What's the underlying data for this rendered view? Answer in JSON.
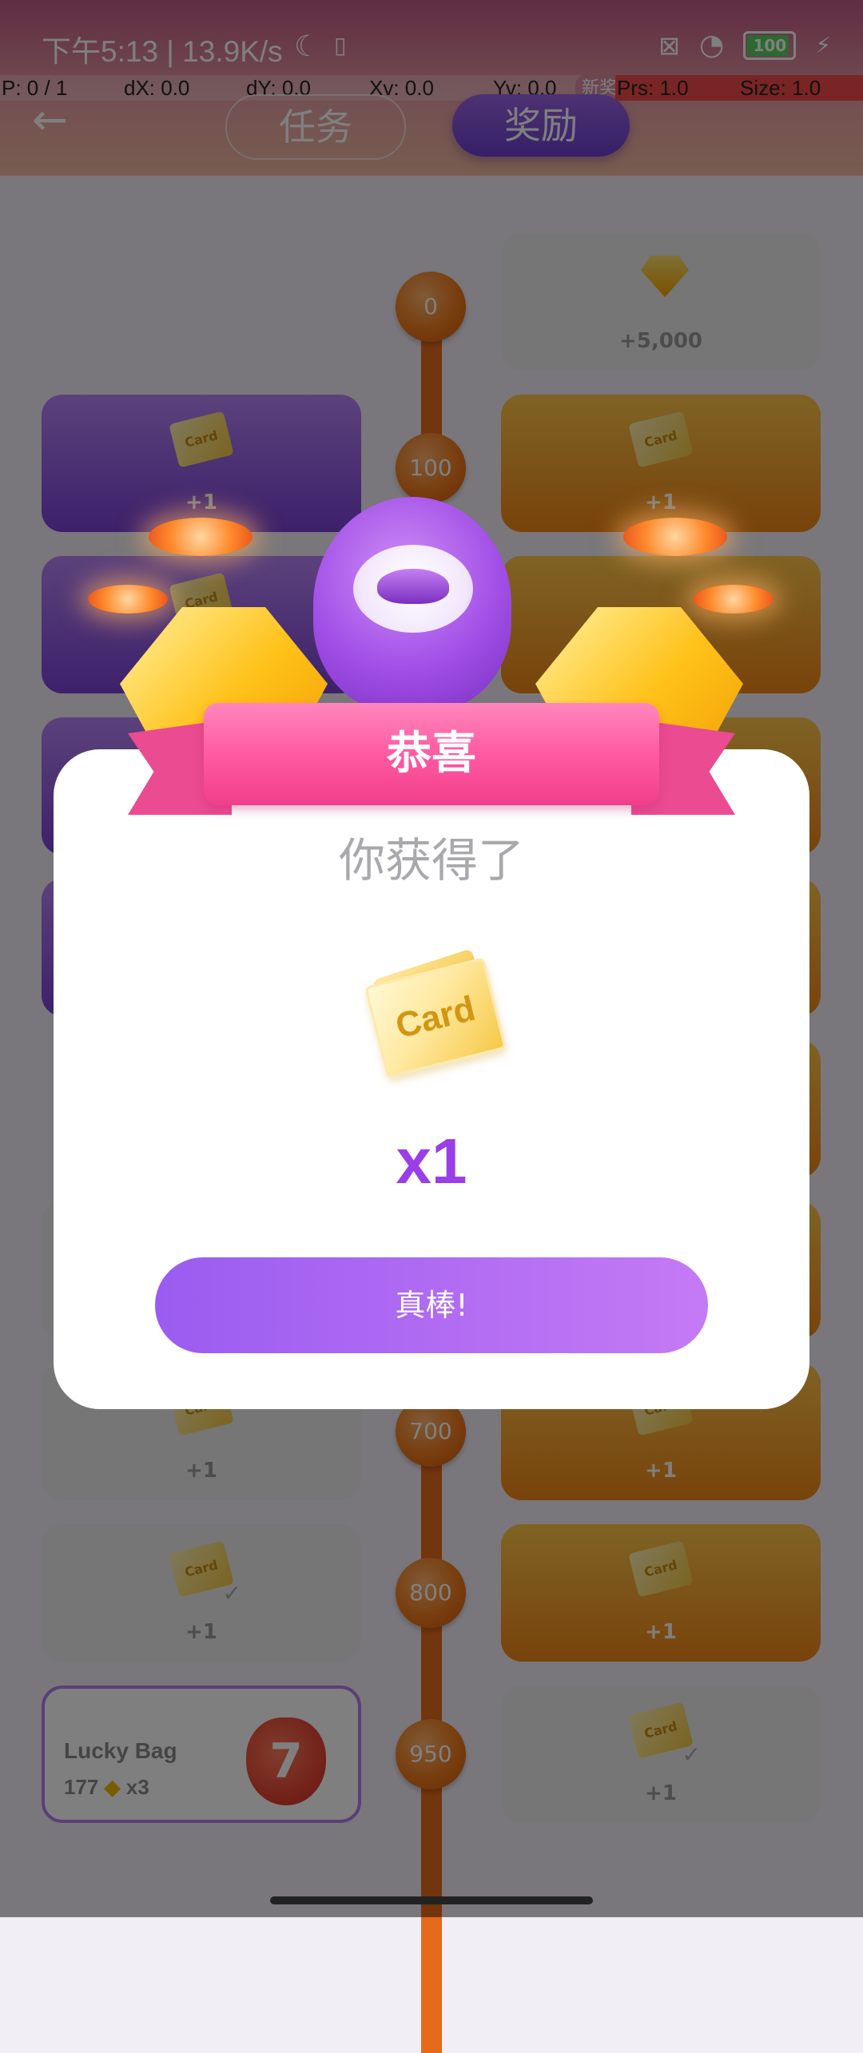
{
  "status_bar": {
    "time_speed": "下午5:13 | 13.9K/s",
    "battery": "100",
    "icons": [
      "moon-icon",
      "sim-icon",
      "no-sim-icon",
      "wifi-icon",
      "battery-icon",
      "charging-icon"
    ]
  },
  "debug_bar": {
    "p": "P: 0 / 1",
    "dx": "dX: 0.0",
    "dy": "dY: 0.0",
    "xv": "Xv: 0.0",
    "yv": "Yv: 0.0",
    "badge": "新奖",
    "prs": "Prs: 1.0",
    "size": "Size: 1.0"
  },
  "tabs": [
    {
      "label": "任务"
    },
    {
      "label": "奖励"
    }
  ],
  "timeline_nodes": [
    "0",
    "100",
    "700",
    "800",
    "950"
  ],
  "reward_rows": {
    "diamond_amount": "+5,000",
    "card_amount": "+1",
    "card_label": "Card",
    "lucky_bag": {
      "title": "Lucky Bag",
      "count": "177",
      "multiplier": "x3",
      "number": "7"
    }
  },
  "dialog": {
    "ribbon_title": "恭喜",
    "subtitle": "你获得了",
    "reward_card_label": "Card",
    "quantity": "x1",
    "confirm_button": "真棒!"
  },
  "colors": {
    "accent_purple": "#9a3ee8",
    "ribbon_pink": "#ff5aa2",
    "timeline_orange": "#e56a1b"
  }
}
